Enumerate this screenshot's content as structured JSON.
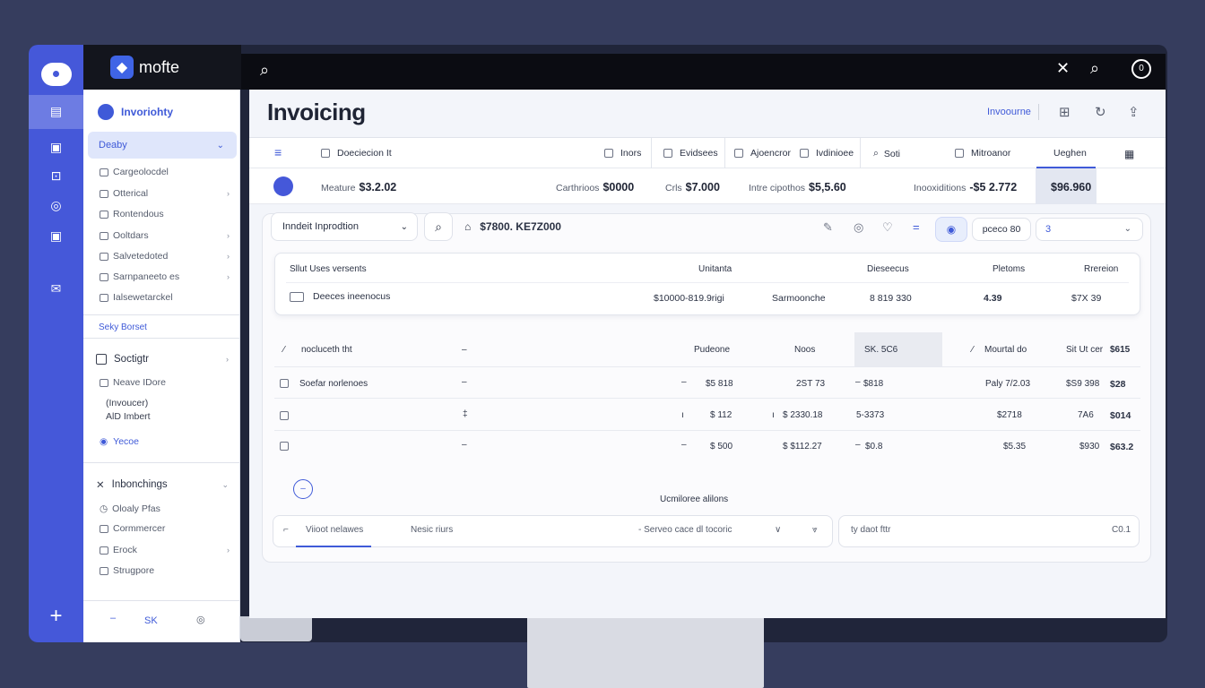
{
  "brand": {
    "name": "mofte"
  },
  "sidebar": {
    "header": "Invoriohty",
    "active": "Deaby",
    "items": [
      {
        "label": "Cargeolocdel",
        "chev": false
      },
      {
        "label": "Otterical",
        "chev": true
      },
      {
        "label": "Rontendous",
        "chev": false
      },
      {
        "label": "Ooltdars",
        "chev": true
      },
      {
        "label": "Salvetedoted",
        "chev": true
      },
      {
        "label": "Sarnpaneeto es",
        "chev": true
      },
      {
        "label": "Ialsewetarckel",
        "chev": false
      }
    ],
    "section": "Seky Borset",
    "group1": {
      "title": "Soctigtr",
      "lines": [
        "Neave IDore",
        "(Invoucer)",
        "AlD Imbert"
      ],
      "extra": "Yecoe"
    },
    "group2": {
      "title": "Inbonchings",
      "items": [
        "Oloaly Pfas",
        "Cormmercer",
        "Erock",
        "Strugpore"
      ]
    },
    "bottom": {
      "label": "SK"
    }
  },
  "header": {
    "title": "Invoicing",
    "link": "Invoourne"
  },
  "tabs": [
    {
      "label": "Doeciecion It"
    },
    {
      "label": "Inors"
    },
    {
      "label": "Evidsees"
    },
    {
      "label": "Ajoencror"
    },
    {
      "label": "Ivdinioee"
    },
    {
      "label": "Soti"
    },
    {
      "label": "Mitroanor"
    },
    {
      "label": "Ueghen"
    }
  ],
  "summary": [
    {
      "label": "Meature",
      "value": "$3.2.02"
    },
    {
      "label": "Carthrioos",
      "value": "$0000"
    },
    {
      "label": "Crls",
      "value": "$7.000"
    },
    {
      "label": "Intre cipothos",
      "value": "$5,5.60"
    },
    {
      "label": "Inooxiditions",
      "value": "-$5 2.772"
    },
    {
      "label": "",
      "value": "$96.960"
    }
  ],
  "filters": {
    "select": "Inndeit Inprodtion",
    "amount": "$7800. KE7Z000",
    "chip": "pceco 80",
    "dropdown": "3"
  },
  "card": {
    "headers": [
      "Sllut Uses versents",
      "Unitanta",
      "Dieseecus",
      "Pletoms",
      "Rrereion"
    ],
    "row": {
      "name": "Deeces ineenocus",
      "amount": "$10000-819.9rigi",
      "status": "Sarmoonche",
      "v1": "8 819 330",
      "v2": "4.39",
      "v3": "$7X 39"
    }
  },
  "lines": {
    "headers": [
      "nocluceth tht",
      "Pudeone",
      "Noos",
      "SK. 5C6",
      "Mourtal do",
      "Sit Ut cer",
      "$615"
    ],
    "rows": [
      {
        "name": "Soefar norlenoes",
        "c1": "$5 818",
        "c2": "2ST 73",
        "c3": "$818",
        "c4": "Paly 7/2.03",
        "c5": "$S9 398",
        "c6": "$28"
      },
      {
        "name": "",
        "c1": "$ 112",
        "c2": "$ 2330.18",
        "c3": "5-3373",
        "c4": "$2718",
        "c5": "7A6",
        "c6": "$014"
      },
      {
        "name": "",
        "c1": "$ 500",
        "c2": "$ $112.27",
        "c3": "$0.8",
        "c4": "$5.35",
        "c5": "$930",
        "c6": "$63.2"
      }
    ]
  },
  "footer": {
    "label": "Ucmiloree alilons",
    "notes": [
      "Viioot nelawes",
      "Nesic riurs",
      "- Serveo cace dl tocoric"
    ],
    "side": "ty daot fttr",
    "side_value": "C0.1"
  },
  "colors": {
    "accent": "#4558d9",
    "rail": "#4558d9",
    "background": "#363d5e"
  },
  "icons": [
    "cloud-icon",
    "calendar-icon",
    "grid-icon",
    "settings-icon",
    "mail-icon",
    "plus-icon",
    "search-icon",
    "close-icon",
    "user-icon"
  ]
}
